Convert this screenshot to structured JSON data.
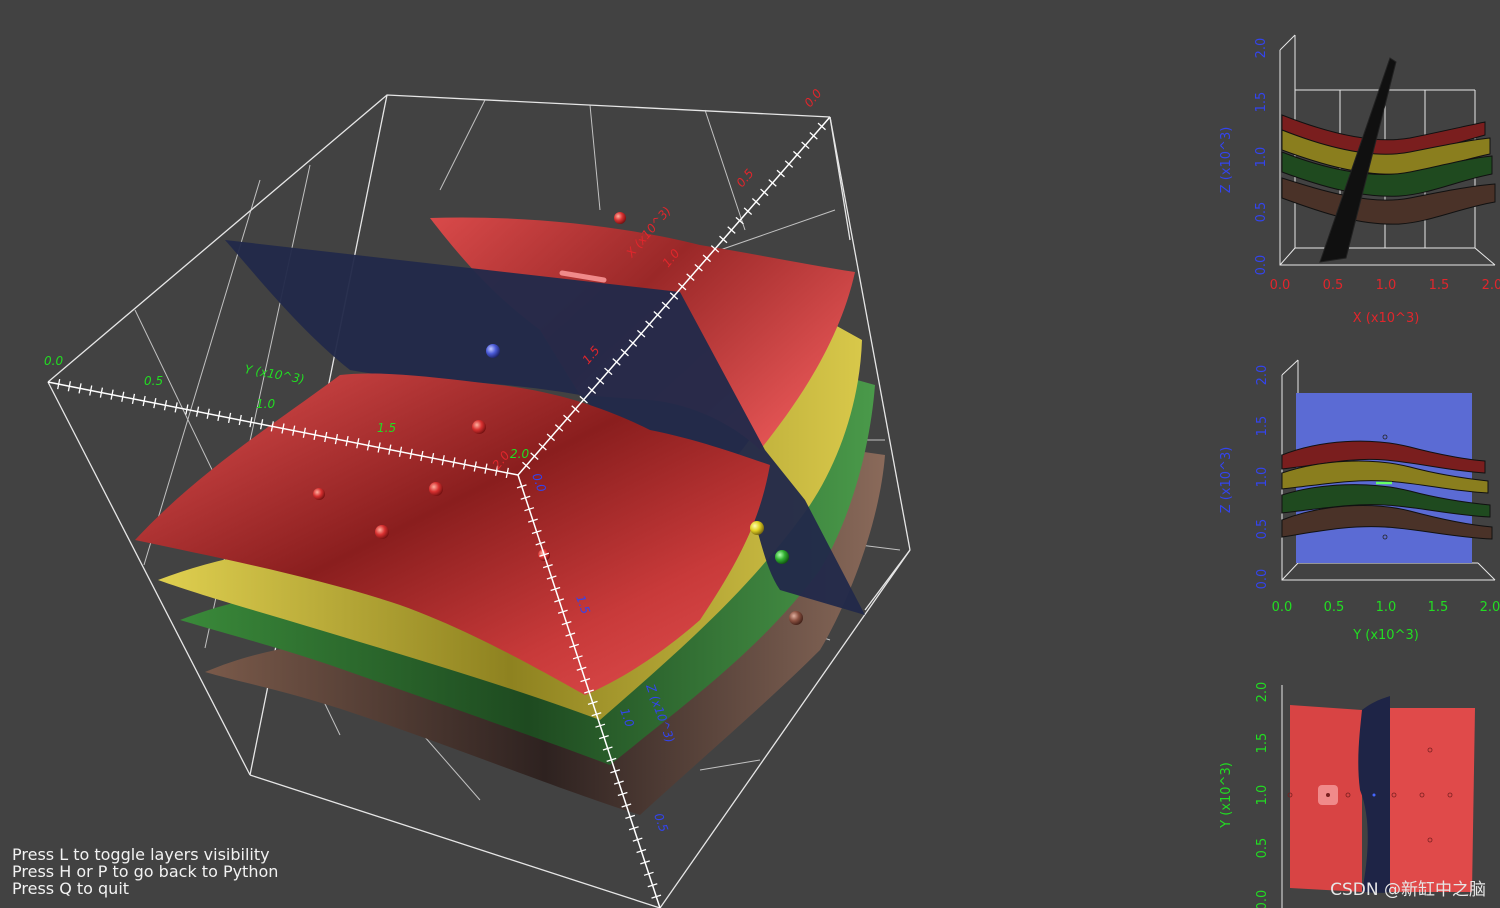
{
  "help_lines": [
    "Press L to toggle layers visibility",
    "Press H or P to go back to Python",
    "Press Q to quit"
  ],
  "watermark": "CSDN @新缸中之脑",
  "colors": {
    "background": "#424242",
    "x_axis": "#e0262c",
    "y_axis": "#22cc22",
    "z_axis": "#2233dd",
    "layer_top": "#d84444",
    "layer_2": "#d6c440",
    "layer_3": "#3c8a3c",
    "layer_4": "#6a4a40",
    "fault_plane": "#222a4a",
    "box_lines": "#e6e6e6"
  },
  "main_view": {
    "x_axis_title": "X (x10^3)",
    "y_axis_title": "Y (x10^3)",
    "z_axis_title": "Z (x10^3)",
    "x_ticks": [
      "0.0",
      "0.5",
      "1.0",
      "1.5",
      "2.0"
    ],
    "y_ticks": [
      "0.0",
      "0.5",
      "1.0",
      "1.5",
      "2.0"
    ],
    "z_ticks": [
      "0.0",
      "0.5",
      "1.0",
      "1.5",
      "2.0"
    ],
    "z_near_ticks": [
      "1.5",
      "1.0",
      "0.5"
    ]
  },
  "panel_xz": {
    "vertical_title": "Z (x10^3)",
    "horizontal_title": "X (x10^3)",
    "vertical_ticks": [
      "2.0",
      "1.5",
      "1.0",
      "0.5",
      "0.0"
    ],
    "horizontal_ticks": [
      "0.0",
      "0.5",
      "1.0",
      "1.5",
      "2.0"
    ]
  },
  "panel_yz": {
    "vertical_title": "Z (x10^3)",
    "horizontal_title": "Y (x10^3)",
    "vertical_ticks": [
      "2.0",
      "1.5",
      "1.0",
      "0.5",
      "0.0"
    ],
    "horizontal_ticks": [
      "0.0",
      "0.5",
      "1.0",
      "1.5",
      "2.0"
    ]
  },
  "panel_xy": {
    "vertical_title": "Y (x10^3)",
    "vertical_ticks": [
      "2.0",
      "1.5",
      "1.0",
      "0.5",
      "0.0"
    ]
  }
}
